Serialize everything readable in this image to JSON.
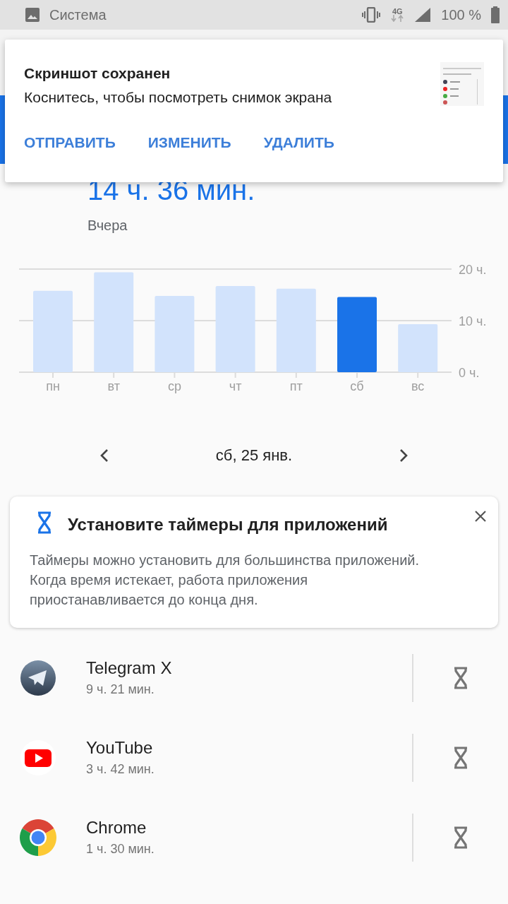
{
  "status_bar": {
    "app": "Система",
    "network_type": "4G",
    "battery": "100 %"
  },
  "notification": {
    "title": "Скриншот сохранен",
    "text": "Коснитесь, чтобы посмотреть снимок экрана",
    "actions": [
      "ОТПРАВИТЬ",
      "ИЗМЕНИТЬ",
      "УДАЛИТЬ"
    ]
  },
  "summary": {
    "total": "14 ч. 36 мин.",
    "period": "Вчера"
  },
  "chart": {
    "chart_data": {
      "type": "bar",
      "categories": [
        "пн",
        "вт",
        "ср",
        "чт",
        "пт",
        "сб",
        "вс"
      ],
      "values": [
        15.8,
        19.4,
        14.8,
        16.7,
        16.2,
        14.6,
        9.3
      ],
      "ylim": [
        0,
        20
      ],
      "yticks": [
        {
          "value": 0,
          "label": "0 ч."
        },
        {
          "value": 10,
          "label": "10 ч."
        },
        {
          "value": 20,
          "label": "20 ч."
        }
      ]
    },
    "bars": [
      {
        "selected": false
      },
      {
        "selected": false
      },
      {
        "selected": false
      },
      {
        "selected": false
      },
      {
        "selected": false
      },
      {
        "selected": true
      },
      {
        "selected": false
      }
    ]
  },
  "date_nav": {
    "date": "сб, 25 янв."
  },
  "tip_card": {
    "title": "Установите таймеры для приложений",
    "text": "Таймеры можно установить для большинства приложений. Когда время истекает, работа приложения приостанавливается до конца дня."
  },
  "apps": [
    {
      "kind": "telegram",
      "name": "Telegram X",
      "time": "9 ч. 21 мин."
    },
    {
      "kind": "youtube",
      "name": "YouTube",
      "time": "3 ч. 42 мин."
    },
    {
      "kind": "chrome",
      "name": "Chrome",
      "time": "1 ч. 30 мин."
    }
  ]
}
